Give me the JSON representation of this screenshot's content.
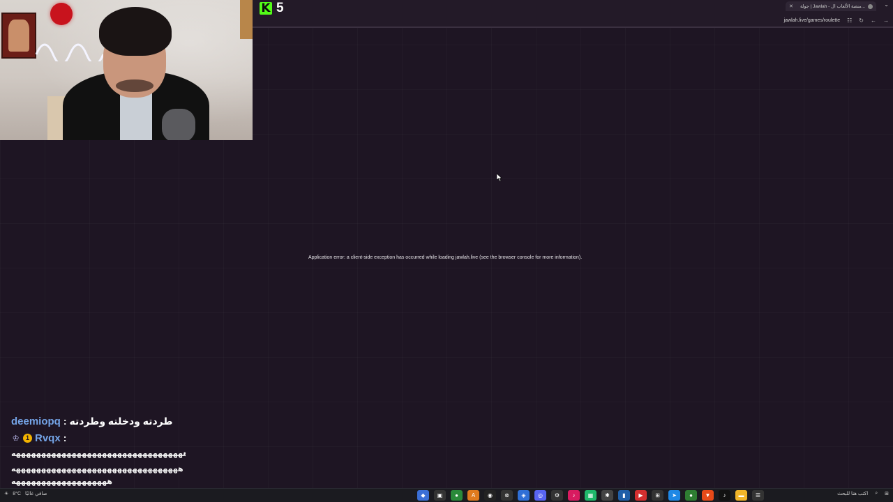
{
  "browser": {
    "tab_title": "جولة | Jawlah - منصة الألعاب ال...",
    "url": "jawlah.live/games/roulette"
  },
  "stream": {
    "kick_viewer_count": "5"
  },
  "page": {
    "error_message": "Application error: a client-side exception has occurred while loading jawlah.live (see the browser console for more information)."
  },
  "chat": {
    "messages": [
      {
        "user": "deemiopq",
        "separator": ":",
        "text": "طردته ودخلته وطردته",
        "user_color": "#74a4e7"
      },
      {
        "user": "Rvqx",
        "separator": ":",
        "text": "",
        "user_color": "#74a4e7"
      }
    ],
    "spam_lines": [
      "ههههههههههههههههههههههههههههههههههه",
      "هههههههههههههههههههههههههههههههههه",
      "هههههههههههههههههههه"
    ]
  },
  "taskbar": {
    "weather": "8°C",
    "weather_desc": "صافي غالبًا",
    "search_placeholder": "اكتب هنا للبحث"
  },
  "colors": {
    "kick_green": "#53fc18",
    "page_bg": "#1e1523",
    "chat_user": "#74a4e7"
  }
}
